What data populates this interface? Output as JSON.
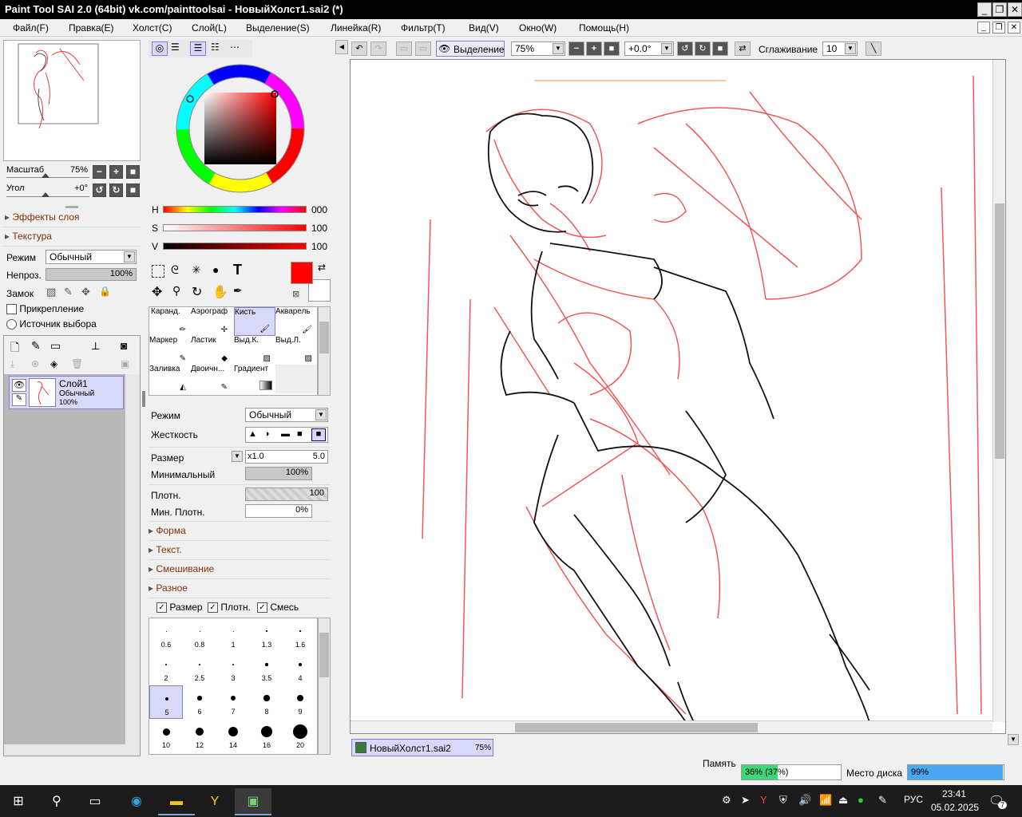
{
  "window": {
    "title": "Paint Tool SAI 2.0 (64bit) vk.com/painttoolsai - НовыйХолст1.sai2 (*)"
  },
  "menu": [
    "Файл(F)",
    "Правка(E)",
    "Холст(C)",
    "Слой(L)",
    "Выделение(S)",
    "Линейка(R)",
    "Фильтр(T)",
    "Вид(V)",
    "Окно(W)",
    "Помощь(H)"
  ],
  "navigator": {
    "zoom_label": "Масштаб",
    "zoom_value": "75%",
    "angle_label": "Угол",
    "angle_value": "+0°"
  },
  "layer_panel": {
    "effects_label": "Эффекты слоя",
    "texture_label": "Текстура",
    "mode_label": "Режим",
    "mode_value": "Обычный",
    "opacity_label": "Непроз.",
    "opacity_value": "100%",
    "lock_label": "Замок",
    "clipping_label": "Прикрепление",
    "selection_source_label": "Источник выбора",
    "layer": {
      "name": "Слой1",
      "mode": "Обычный",
      "opacity": "100%"
    }
  },
  "color": {
    "h_label": "H",
    "h_value": "000",
    "s_label": "S",
    "s_value": "100",
    "v_label": "V",
    "v_value": "100",
    "primary": "#ff0000",
    "secondary": "#ffffff"
  },
  "tools": [
    [
      "Каранд.",
      "Аэрограф",
      "Кисть",
      "Акварель"
    ],
    [
      "Маркер",
      "Ластик",
      "Выд.К.",
      "Выд.Л."
    ],
    [
      "Заливка",
      "Двоичн...",
      "Градиент",
      ""
    ]
  ],
  "brush": {
    "mode_label": "Режим",
    "mode_value": "Обычный",
    "hardness_label": "Жесткость",
    "size_label": "Размер",
    "size_mult": "x1.0",
    "size_value": "5.0",
    "min_size_label": "Минимальный",
    "min_size_value": "100%",
    "density_label": "Плотн.",
    "density_value": "100",
    "min_density_label": "Мин. Плотн.",
    "min_density_value": "0%",
    "sections": [
      "Форма",
      "Текст.",
      "Смешивание",
      "Разное"
    ],
    "checks": [
      "Размер",
      "Плотн.",
      "Смесь"
    ],
    "dot_sizes": [
      [
        "0.6",
        "0.8",
        "1",
        "1.3",
        "1.6"
      ],
      [
        "2",
        "2.5",
        "3",
        "3.5",
        "4"
      ],
      [
        "5",
        "6",
        "7",
        "8",
        "9"
      ],
      [
        "10",
        "12",
        "14",
        "16",
        "20"
      ]
    ]
  },
  "canvas_toolbar": {
    "selection_label": "Выделение",
    "zoom_value": "75%",
    "angle_value": "+0.0°",
    "stabilizer_label": "Сглаживание",
    "stabilizer_value": "10"
  },
  "canvas_tab": {
    "name": "НовыйХолст1.sai2",
    "zoom": "75%"
  },
  "status": {
    "memory_label": "Память",
    "memory_value": "36% (37%)",
    "memory_fraction": 0.36,
    "disk_label": "Место диска",
    "disk_value": "99%",
    "disk_fraction": 0.99
  },
  "taskbar": {
    "lang": "РУС",
    "time": "23:41",
    "date": "05.02.2025",
    "notif_count": "7"
  },
  "colors": {
    "sketch_red": "#f03a3a",
    "selected_bg": "#d8d8f8",
    "memory_bar": "#3bd87a",
    "disk_bar": "#4aa8f0"
  }
}
